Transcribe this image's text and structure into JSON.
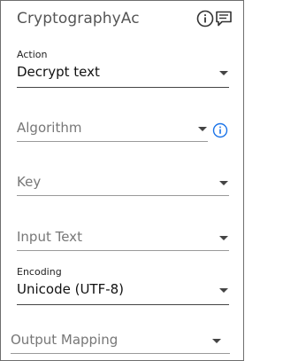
{
  "header": {
    "title": "CryptographyAc",
    "info_icon": "info-icon",
    "comment_icon": "comment-icon"
  },
  "fields": {
    "action": {
      "label": "Action",
      "value": "Decrypt text"
    },
    "algorithm": {
      "placeholder": "Algorithm"
    },
    "key": {
      "placeholder": "Key"
    },
    "input_text": {
      "placeholder": "Input Text"
    },
    "encoding": {
      "label": "Encoding",
      "value": "Unicode (UTF-8)"
    },
    "output_mapping": {
      "placeholder": "Output Mapping"
    }
  },
  "colors": {
    "accent_info": "#1a73e8",
    "text_dark": "#111111",
    "text_muted": "#777777"
  }
}
